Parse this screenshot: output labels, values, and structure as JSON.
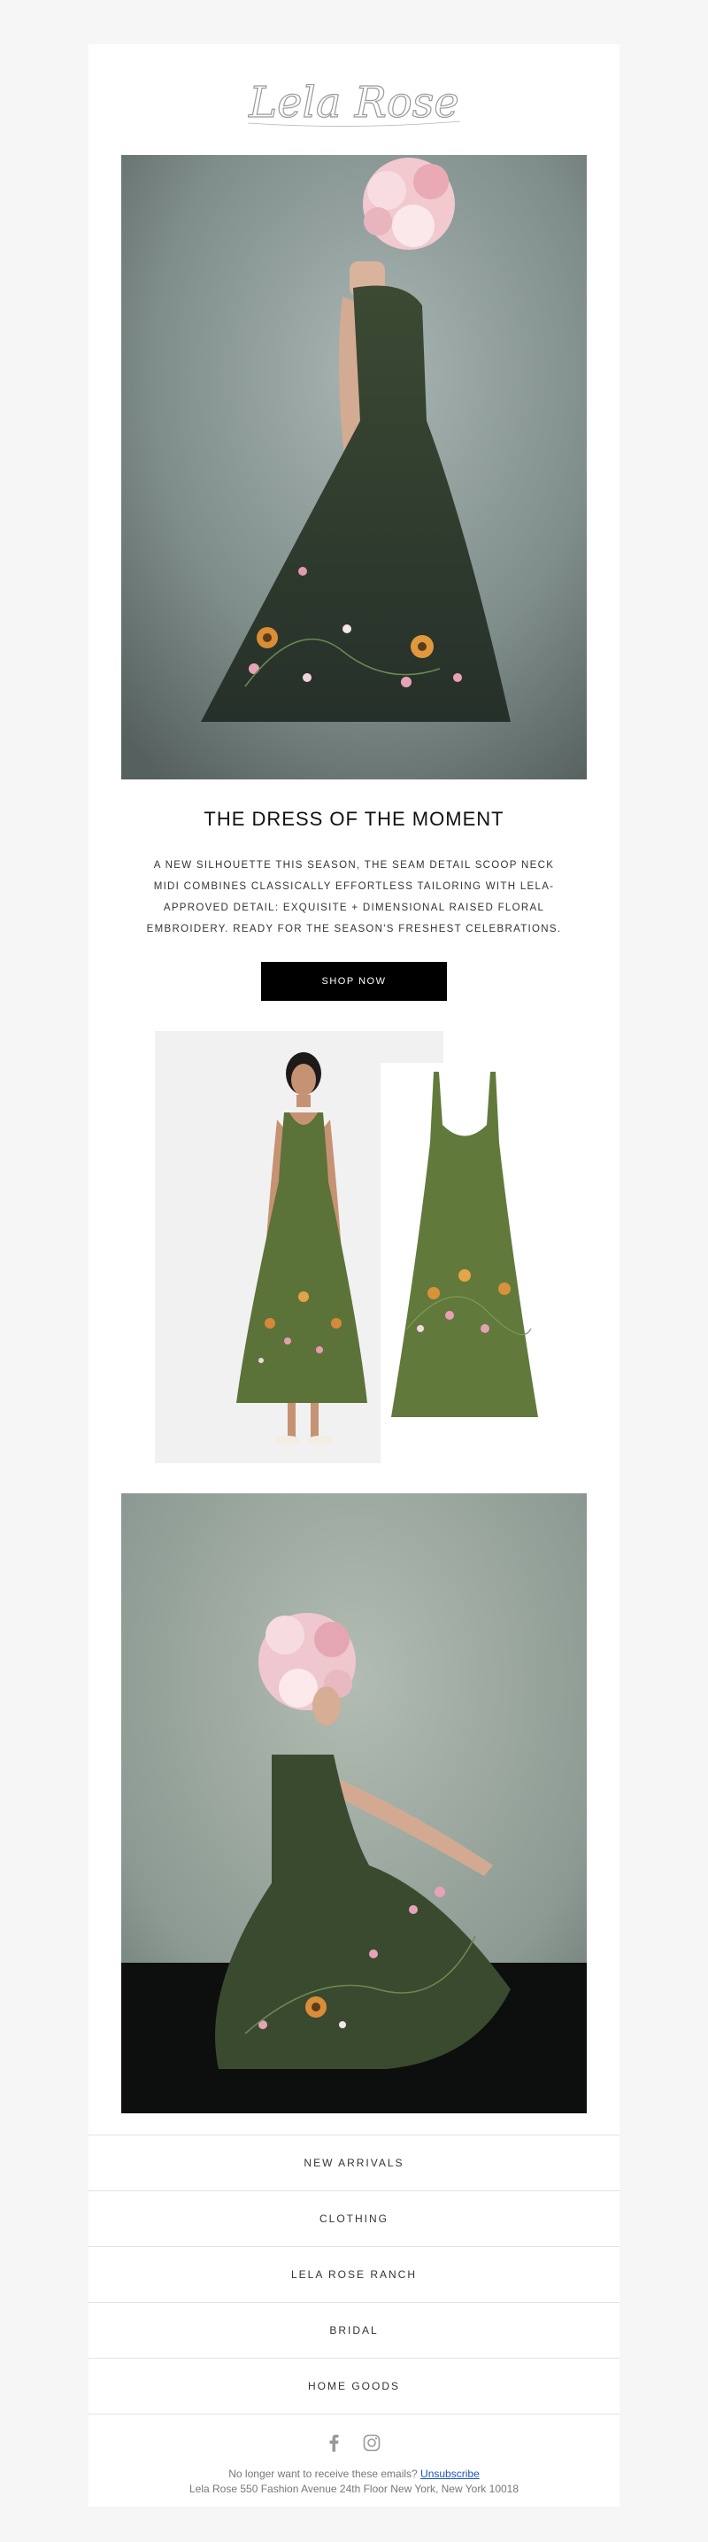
{
  "brand": {
    "logo_text": "Lela Rose"
  },
  "hero": {
    "alt": "Model in green dress with flower crown"
  },
  "headline": "THE DRESS OF THE MOMENT",
  "body_copy": "A NEW SILHOUETTE THIS SEASON, THE SEAM DETAIL SCOOP NECK MIDI COMBINES CLASSICALLY EFFORTLESS TAILORING WITH LELA-APPROVED DETAIL: EXQUISITE + DIMENSIONAL RAISED FLORAL EMBROIDERY. READY FOR THE SEASON'S FRESHEST CELEBRATIONS.",
  "cta": {
    "label": "SHOP NOW"
  },
  "nav": {
    "items": [
      {
        "label": "NEW ARRIVALS"
      },
      {
        "label": "CLOTHING"
      },
      {
        "label": "LELA ROSE RANCH"
      },
      {
        "label": "BRIDAL"
      },
      {
        "label": "HOME GOODS"
      }
    ]
  },
  "social": {
    "icons": [
      "facebook-icon",
      "instagram-icon"
    ]
  },
  "footer": {
    "unsubscribe_prompt": "No longer want to receive these emails?",
    "unsubscribe_link": "Unsubscribe",
    "address": "Lela Rose 550 Fashion Avenue 24th Floor New York, New York 10018"
  },
  "colors": {
    "page_bg": "#f6f6f6",
    "card_bg": "#ffffff",
    "dress_green": "#5b7338",
    "cta_bg": "#000000",
    "link": "#1a56b8"
  }
}
